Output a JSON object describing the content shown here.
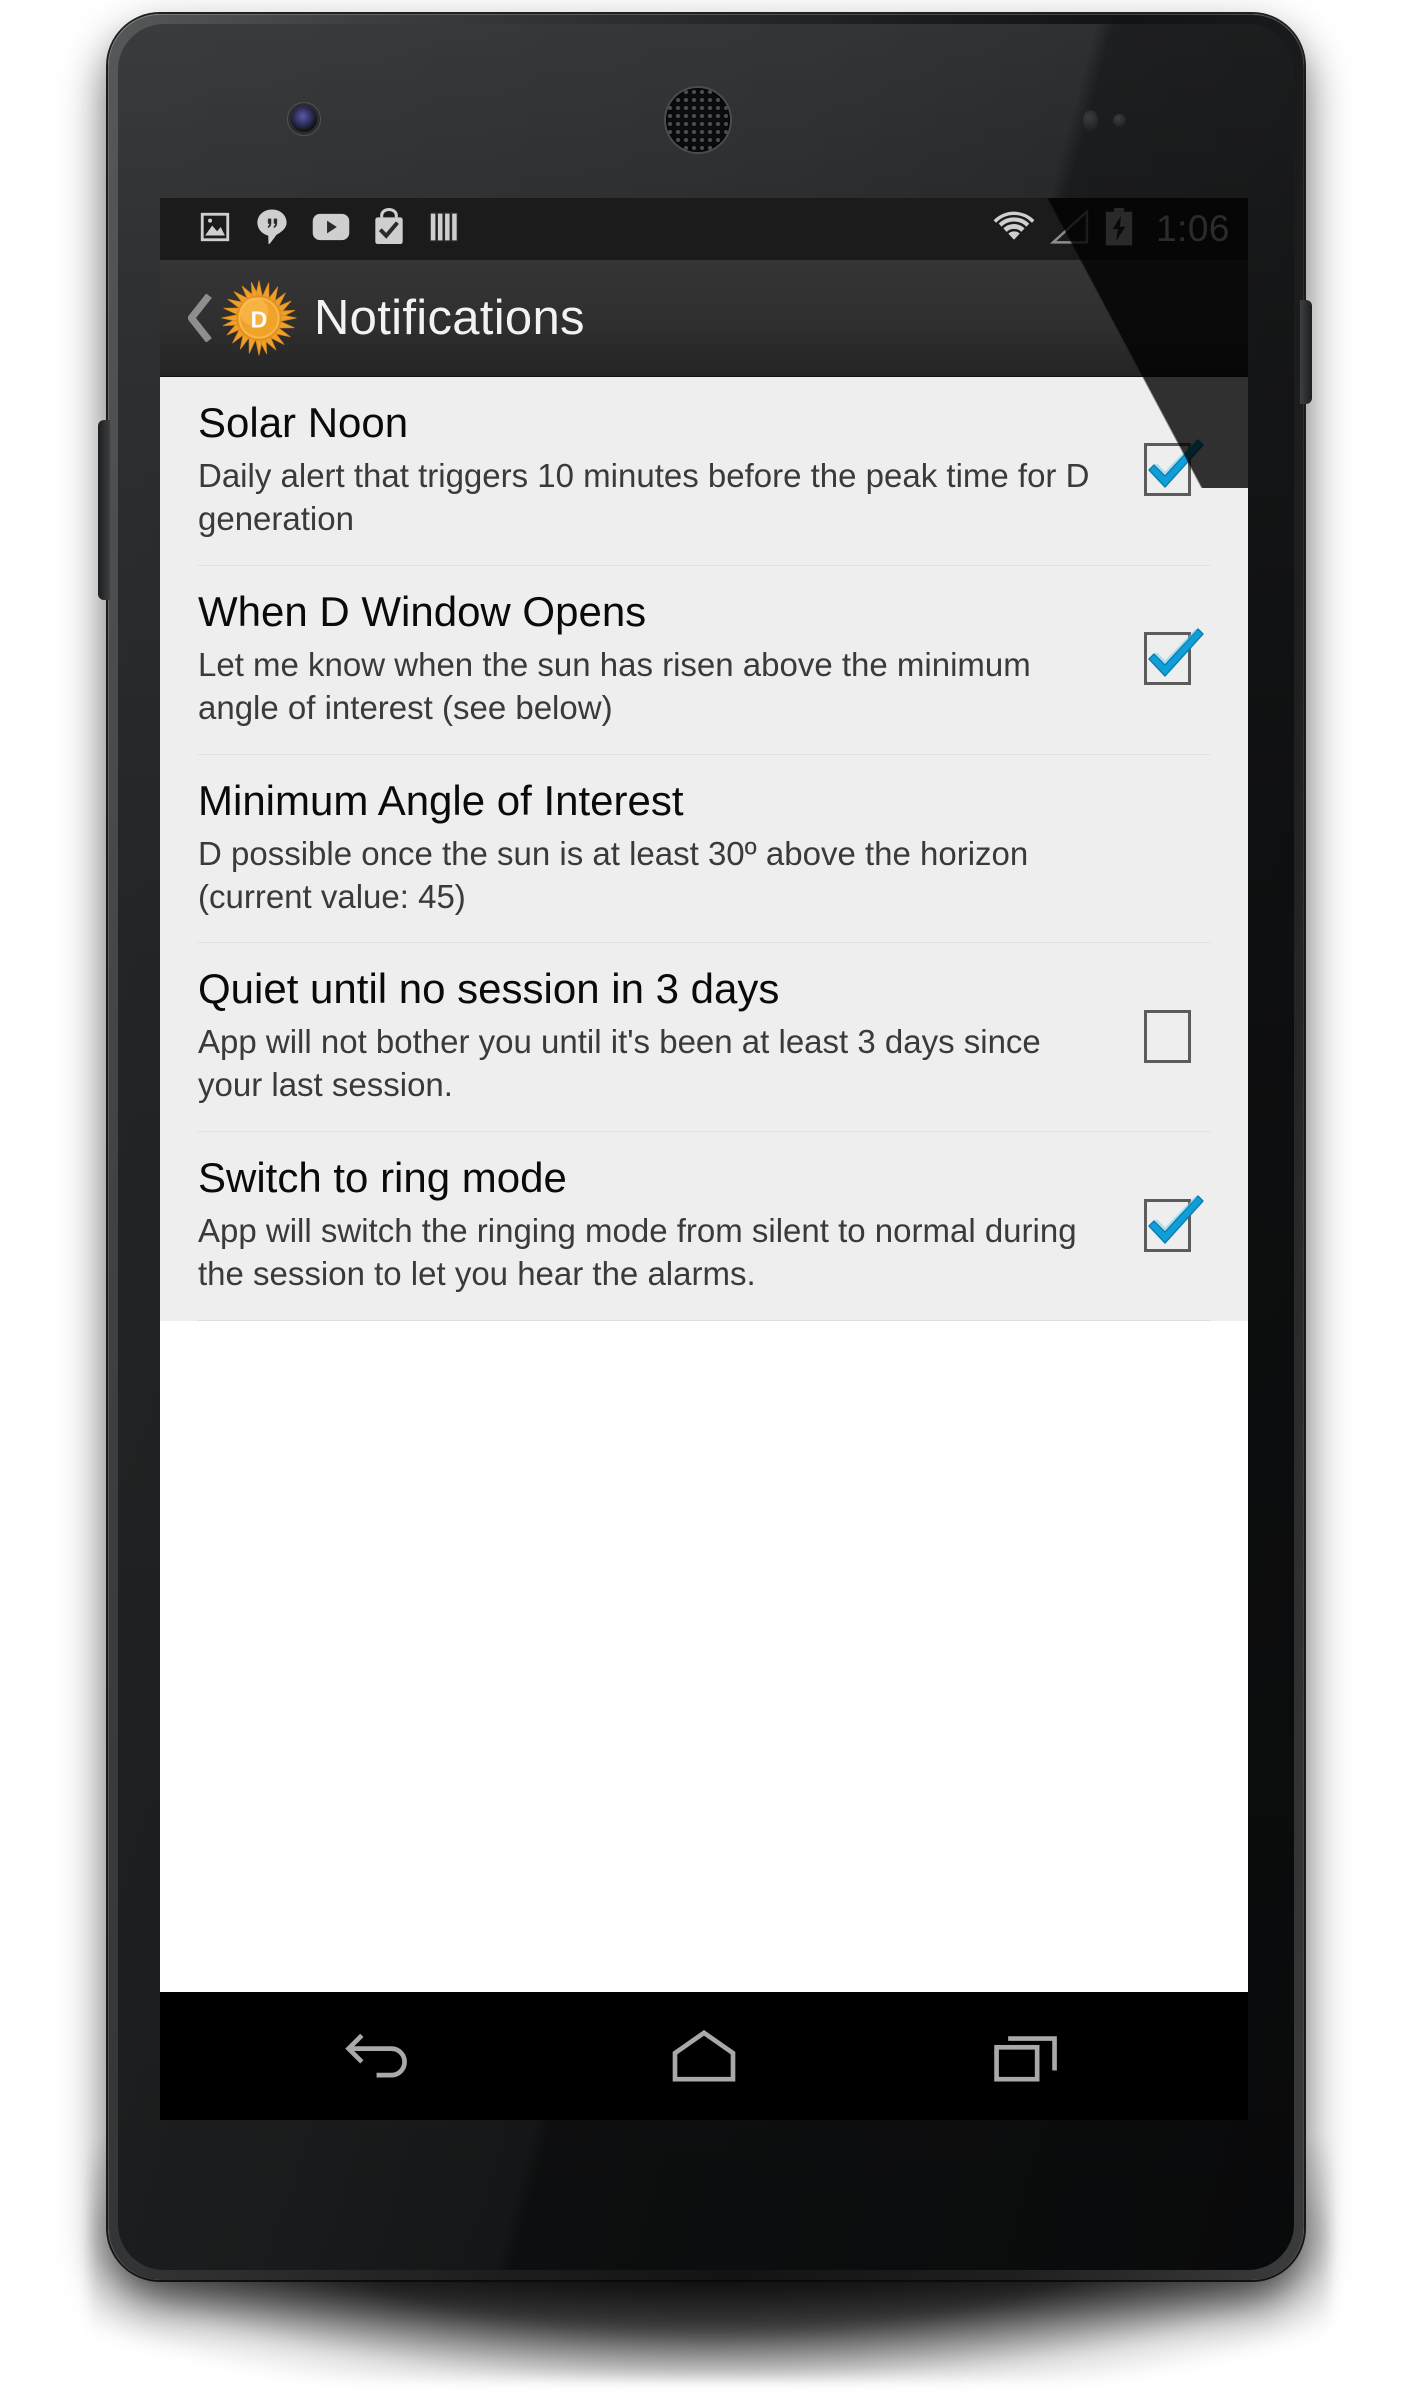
{
  "device": {
    "name": "android-phone-nexus5",
    "camera_icon": "front-camera-icon",
    "speaker_icon": "earpiece-speaker-icon",
    "sensor_icon": "proximity-sensor-icon"
  },
  "statusbar": {
    "time": "1:06",
    "left_icons": [
      {
        "name": "photos-icon",
        "label": "Photos"
      },
      {
        "name": "hangouts-icon",
        "label": "Hangouts"
      },
      {
        "name": "youtube-icon",
        "label": "YouTube"
      },
      {
        "name": "play-store-icon",
        "label": "Play Store"
      },
      {
        "name": "books-icon",
        "label": "Books"
      }
    ],
    "right_icons": [
      {
        "name": "wifi-icon",
        "label": "Wi-Fi"
      },
      {
        "name": "cell-signal-icon",
        "label": "Cellular signal"
      },
      {
        "name": "battery-charging-icon",
        "label": "Battery charging"
      }
    ]
  },
  "actionbar": {
    "back_icon": "back-chevron-icon",
    "app_icon": "sun-d-icon",
    "app_icon_letter": "D",
    "title": "Notifications"
  },
  "colors": {
    "accent_checkbox": "#0f9ed8",
    "actionbar_bg": "#2f2f2f",
    "statusbar_bg": "#1b1b1b",
    "list_bg": "#eeeeee",
    "sun_orange": "#f4a325",
    "sun_core": "#fbb943"
  },
  "preferences": [
    {
      "title": "Solar Noon",
      "summary": "Daily alert that triggers 10 minutes before the peak time for D generation",
      "has_checkbox": true,
      "checked": true
    },
    {
      "title": "When D Window Opens",
      "summary": "Let me know when the sun has risen above the minimum angle of interest (see below)",
      "has_checkbox": true,
      "checked": true
    },
    {
      "title": "Minimum Angle of Interest",
      "summary": "D possible once the sun is at least 30º above the horizon (current value: 45)",
      "has_checkbox": false,
      "checked": false
    },
    {
      "title": "Quiet until no session in 3 days",
      "summary": "App will not bother you until it's been at least 3 days since your last session.",
      "has_checkbox": true,
      "checked": false
    },
    {
      "title": "Switch to ring mode",
      "summary": "App will switch the ringing mode from silent to normal during the session to let you hear the alarms.",
      "has_checkbox": true,
      "checked": true
    }
  ],
  "navbar": {
    "buttons": [
      {
        "name": "nav-back-button",
        "label": "Back"
      },
      {
        "name": "nav-home-button",
        "label": "Home"
      },
      {
        "name": "nav-recents-button",
        "label": "Recents"
      }
    ]
  }
}
